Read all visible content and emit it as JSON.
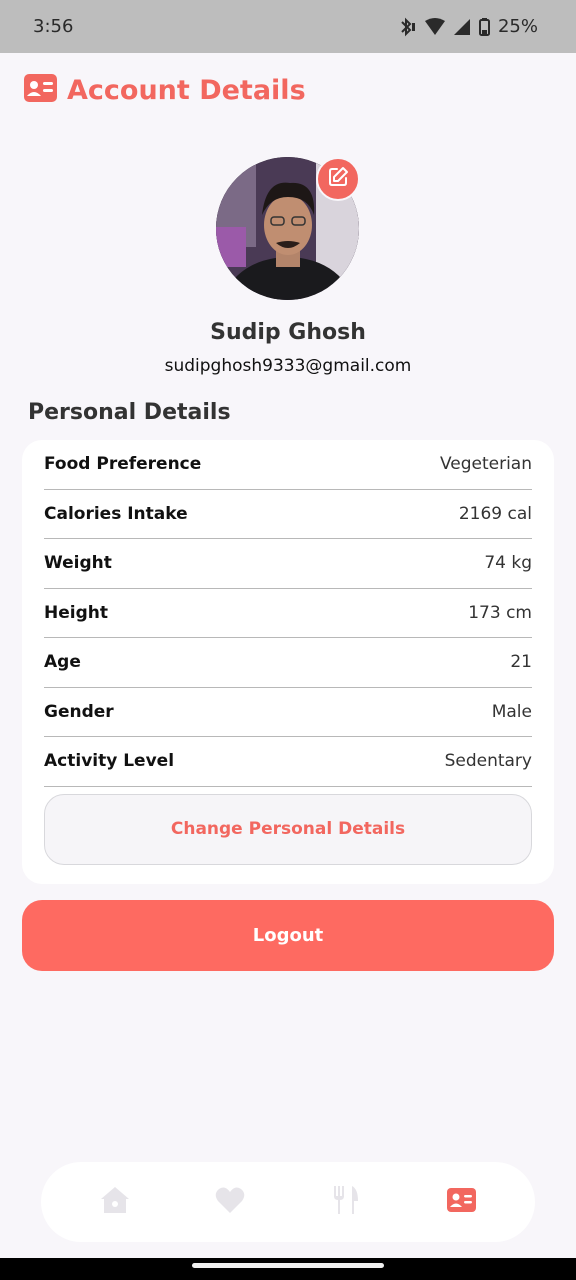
{
  "status_bar": {
    "time": "3:56",
    "battery": "25%"
  },
  "header": {
    "title": "Account Details",
    "icon": "id-card-icon"
  },
  "profile": {
    "name": "Sudip Ghosh",
    "email": "sudipghosh9333@gmail.com"
  },
  "personal_details": {
    "title": "Personal Details",
    "rows": [
      {
        "label": "Food Preference",
        "value": "Vegeterian"
      },
      {
        "label": "Calories Intake",
        "value": "2169 cal"
      },
      {
        "label": "Weight",
        "value": "74 kg"
      },
      {
        "label": "Height",
        "value": "173 cm"
      },
      {
        "label": "Age",
        "value": "21"
      },
      {
        "label": "Gender",
        "value": "Male"
      },
      {
        "label": "Activity Level",
        "value": "Sedentary"
      }
    ],
    "change_button": "Change Personal Details"
  },
  "logout_button": "Logout",
  "bottom_nav": {
    "items": [
      {
        "icon": "home-icon",
        "active": false
      },
      {
        "icon": "heart-icon",
        "active": false
      },
      {
        "icon": "fork-knife-icon",
        "active": false
      },
      {
        "icon": "id-card-icon",
        "active": true
      }
    ]
  },
  "colors": {
    "accent": "#f2675f",
    "logout": "#fe6a61",
    "background": "#f8f6fa",
    "nav_inactive": "#e5e3e8"
  }
}
